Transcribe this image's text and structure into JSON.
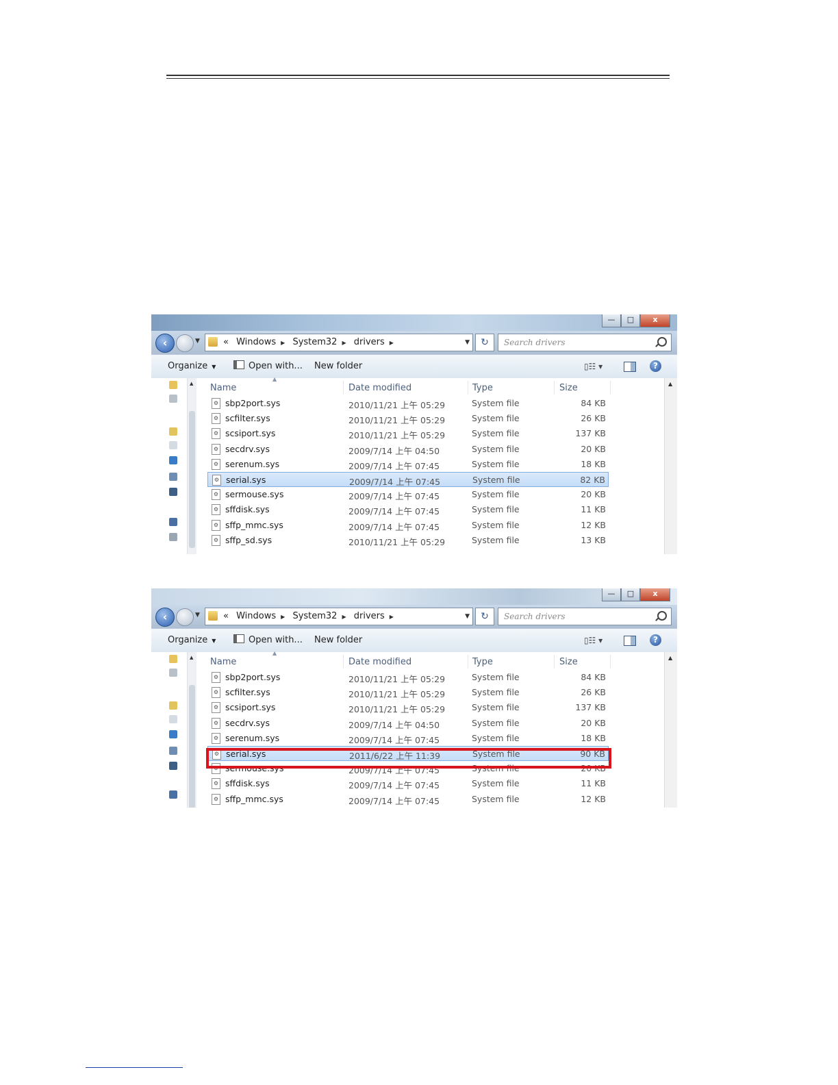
{
  "screenshots": [
    {
      "caption_buttons": {
        "minimize": "—",
        "maximize": "□",
        "close": "x"
      },
      "address": {
        "prefix": "«",
        "crumbs": [
          "Windows",
          "System32",
          "drivers"
        ],
        "search_placeholder": "Search drivers",
        "refresh_icon": "↻"
      },
      "toolbar": {
        "organize": "Organize",
        "open_with": "Open with...",
        "new_folder": "New folder",
        "views": "▯☷ ▾",
        "help": "?"
      },
      "columns": {
        "name": "Name",
        "date": "Date modified",
        "type": "Type",
        "size": "Size"
      },
      "files": [
        {
          "name": "sbp2port.sys",
          "date": "2010/11/21 上午 05:29",
          "type": "System file",
          "size": "84 KB"
        },
        {
          "name": "scfilter.sys",
          "date": "2010/11/21 上午 05:29",
          "type": "System file",
          "size": "26 KB"
        },
        {
          "name": "scsiport.sys",
          "date": "2010/11/21 上午 05:29",
          "type": "System file",
          "size": "137 KB"
        },
        {
          "name": "secdrv.sys",
          "date": "2009/7/14 上午 04:50",
          "type": "System file",
          "size": "20 KB"
        },
        {
          "name": "serenum.sys",
          "date": "2009/7/14 上午 07:45",
          "type": "System file",
          "size": "18 KB"
        },
        {
          "name": "serial.sys",
          "date": "2009/7/14 上午 07:45",
          "type": "System file",
          "size": "82 KB",
          "selected": true
        },
        {
          "name": "sermouse.sys",
          "date": "2009/7/14 上午 07:45",
          "type": "System file",
          "size": "20 KB"
        },
        {
          "name": "sffdisk.sys",
          "date": "2009/7/14 上午 07:45",
          "type": "System file",
          "size": "11 KB"
        },
        {
          "name": "sffp_mmc.sys",
          "date": "2009/7/14 上午 07:45",
          "type": "System file",
          "size": "12 KB"
        },
        {
          "name": "sffp_sd.sys",
          "date": "2010/11/21 上午 05:29",
          "type": "System file",
          "size": "13 KB"
        }
      ]
    },
    {
      "caption_buttons": {
        "minimize": "—",
        "maximize": "□",
        "close": "x"
      },
      "address": {
        "prefix": "«",
        "crumbs": [
          "Windows",
          "System32",
          "drivers"
        ],
        "search_placeholder": "Search drivers",
        "refresh_icon": "↻"
      },
      "toolbar": {
        "organize": "Organize",
        "open_with": "Open with...",
        "new_folder": "New folder",
        "views": "▯☷ ▾",
        "help": "?"
      },
      "columns": {
        "name": "Name",
        "date": "Date modified",
        "type": "Type",
        "size": "Size"
      },
      "files": [
        {
          "name": "sbp2port.sys",
          "date": "2010/11/21 上午 05:29",
          "type": "System file",
          "size": "84 KB"
        },
        {
          "name": "scfilter.sys",
          "date": "2010/11/21 上午 05:29",
          "type": "System file",
          "size": "26 KB"
        },
        {
          "name": "scsiport.sys",
          "date": "2010/11/21 上午 05:29",
          "type": "System file",
          "size": "137 KB"
        },
        {
          "name": "secdrv.sys",
          "date": "2009/7/14 上午 04:50",
          "type": "System file",
          "size": "20 KB"
        },
        {
          "name": "serenum.sys",
          "date": "2009/7/14 上午 07:45",
          "type": "System file",
          "size": "18 KB"
        },
        {
          "name": "serial.sys",
          "date": "2011/6/22 上午 11:39",
          "type": "System file",
          "size": "90 KB",
          "selected": true,
          "highlighted": true
        },
        {
          "name": "sermouse.sys",
          "date": "2009/7/14 上午 07:45",
          "type": "System file",
          "size": "20 KB"
        },
        {
          "name": "sffdisk.sys",
          "date": "2009/7/14 上午 07:45",
          "type": "System file",
          "size": "11 KB"
        },
        {
          "name": "sffp_mmc.sys",
          "date": "2009/7/14 上午 07:45",
          "type": "System file",
          "size": "12 KB"
        }
      ],
      "highlight_color": "#d8141c"
    }
  ],
  "colors": {
    "selection": "#c3dcf8",
    "highlight_border": "#d8141c"
  }
}
